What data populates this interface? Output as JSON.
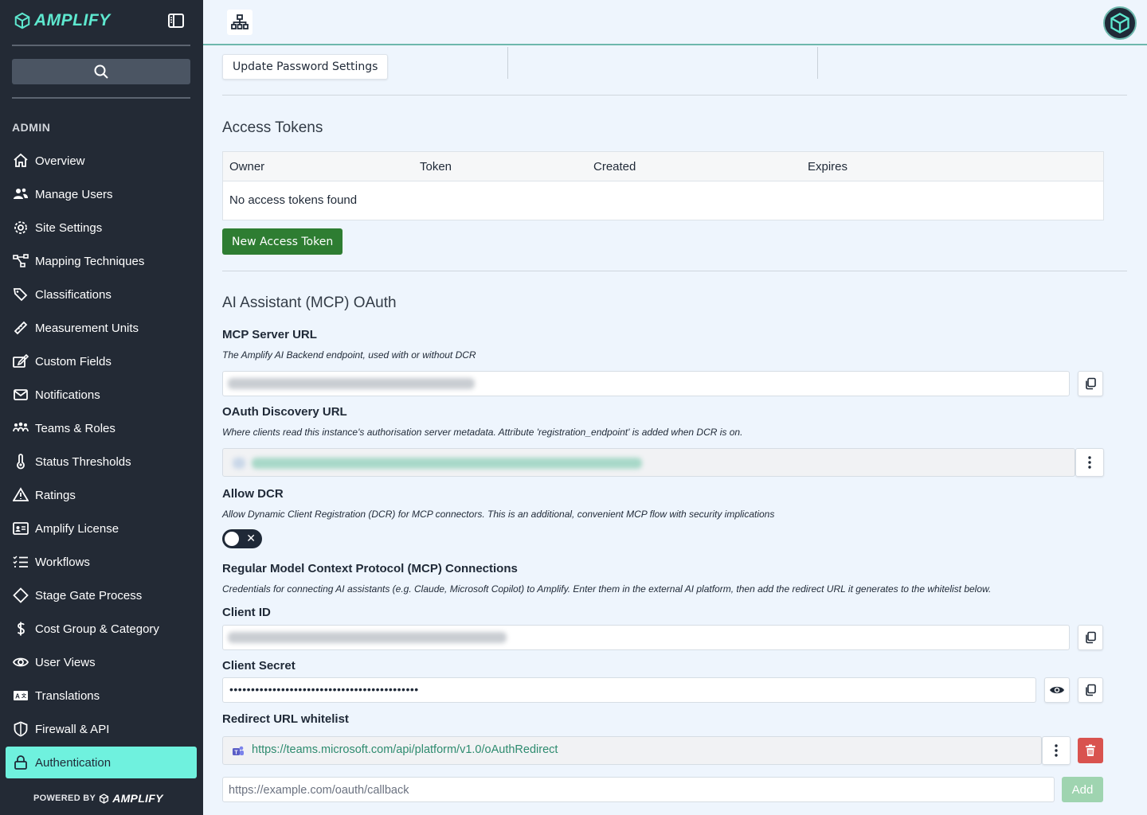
{
  "brand": {
    "name": "AMPLIFY",
    "powered_by": "POWERED BY",
    "powered_brand": "AMPLIFY"
  },
  "sidebar": {
    "section": "ADMIN",
    "items": [
      {
        "label": "Overview",
        "icon": "home-icon"
      },
      {
        "label": "Manage Users",
        "icon": "users-icon"
      },
      {
        "label": "Site Settings",
        "icon": "gear-icon"
      },
      {
        "label": "Mapping Techniques",
        "icon": "network-icon"
      },
      {
        "label": "Classifications",
        "icon": "tags-icon"
      },
      {
        "label": "Measurement Units",
        "icon": "ruler-icon"
      },
      {
        "label": "Custom Fields",
        "icon": "edit-form-icon"
      },
      {
        "label": "Notifications",
        "icon": "envelope-icon"
      },
      {
        "label": "Teams & Roles",
        "icon": "team-icon"
      },
      {
        "label": "Status Thresholds",
        "icon": "thermometer-icon"
      },
      {
        "label": "Ratings",
        "icon": "warning-triangle-icon"
      },
      {
        "label": "Amplify License",
        "icon": "id-card-icon"
      },
      {
        "label": "Workflows",
        "icon": "checklist-icon"
      },
      {
        "label": "Stage Gate Process",
        "icon": "diamond-icon"
      },
      {
        "label": "Cost Group & Category",
        "icon": "dollar-icon"
      },
      {
        "label": "User Views",
        "icon": "eye-icon"
      },
      {
        "label": "Translations",
        "icon": "translate-icon"
      },
      {
        "label": "Firewall & API",
        "icon": "shield-icon"
      },
      {
        "label": "Authentication",
        "icon": "lock-icon",
        "active": true
      }
    ]
  },
  "main": {
    "update_password_label": "Update Password Settings",
    "access_tokens": {
      "title": "Access Tokens",
      "columns": [
        "Owner",
        "Token",
        "Created",
        "Expires"
      ],
      "empty_text": "No access tokens found",
      "new_button": "New Access Token"
    },
    "mcp": {
      "title": "AI Assistant (MCP) OAuth",
      "server_url": {
        "label": "MCP Server URL",
        "help": "The Amplify AI Backend endpoint, used with or without DCR"
      },
      "discovery_url": {
        "label": "OAuth Discovery URL",
        "help": "Where clients read this instance's authorisation server metadata. Attribute 'registration_endpoint' is added when DCR is on."
      },
      "allow_dcr": {
        "label": "Allow DCR",
        "help": "Allow Dynamic Client Registration (DCR) for MCP connectors. This is an additional, convenient MCP flow with security implications",
        "enabled": false
      },
      "regular": {
        "label": "Regular Model Context Protocol (MCP) Connections",
        "help": "Credentials for connecting AI assistants (e.g. Claude, Microsoft Copilot) to Amplify. Enter them in the external AI platform, then add the redirect URL it generates to the whitelist below."
      },
      "client_id": {
        "label": "Client ID"
      },
      "client_secret": {
        "label": "Client Secret",
        "value": "••••••••••••••••••••••••••••••••••••••••••••"
      },
      "redirect": {
        "label": "Redirect URL whitelist",
        "entries": [
          "https://teams.microsoft.com/api/platform/v1.0/oAuthRedirect"
        ],
        "placeholder": "https://example.com/oauth/callback",
        "add_label": "Add"
      }
    }
  },
  "colors": {
    "sidebar": "#232a35",
    "accent": "#6ff1de",
    "brand": "#5ee8cf",
    "primary_green": "#2e7d32",
    "danger": "#d9534f"
  }
}
